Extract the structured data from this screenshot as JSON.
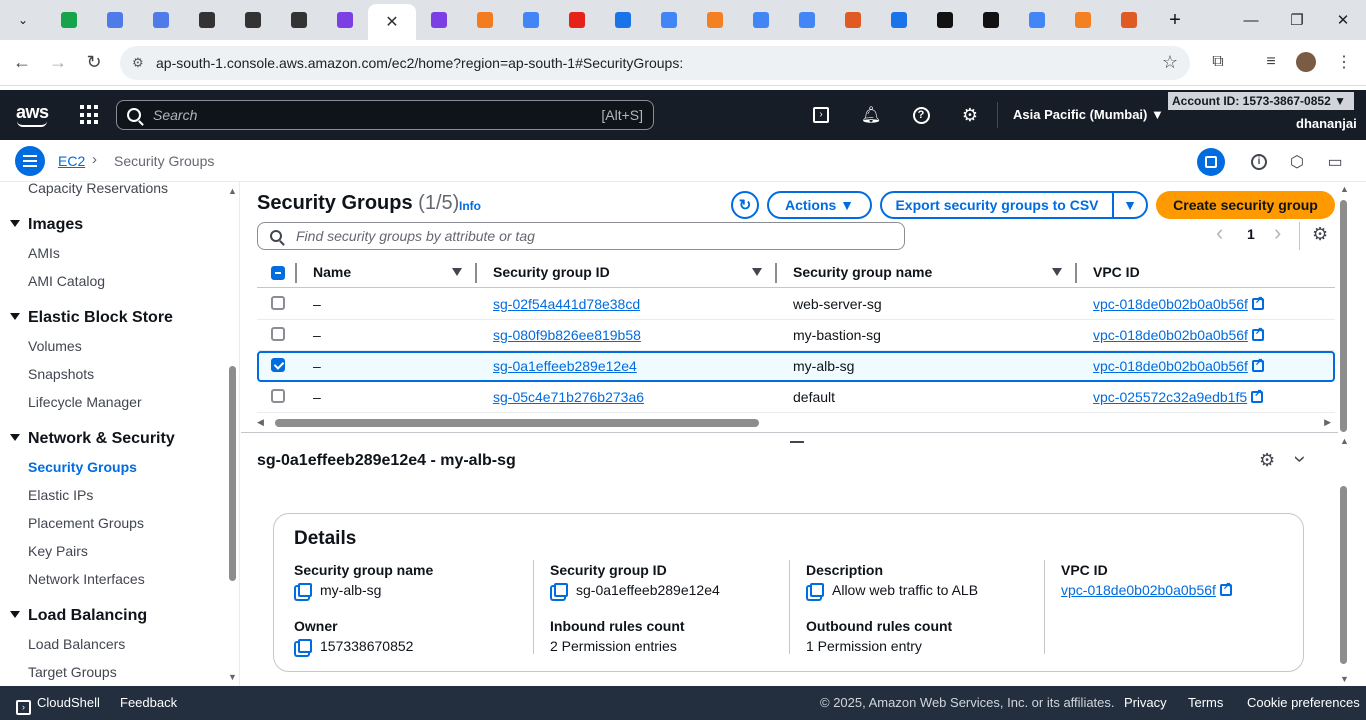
{
  "browser": {
    "active_tab_close": "✕",
    "new_tab": "+",
    "url": "ap-south-1.console.aws.amazon.com/ec2/home?region=ap-south-1#SecurityGroups:",
    "tab_favicon_colors": [
      "#16a34a",
      "#4f7be8",
      "#4f7be8",
      "#333",
      "#333",
      "#333",
      "#7b3fe4",
      "#7b3fe4",
      "#f47c20",
      "#4285f4",
      "#e62117",
      "#1a73e8",
      "#4285f4",
      "#f48024",
      "#4285f4",
      "#4285f4",
      "#e05a24",
      "#1a73e8",
      "#111",
      "#111",
      "#4285f4",
      "#f48024",
      "#e05a24"
    ]
  },
  "aws_nav": {
    "logo": "aws",
    "search_placeholder": "Search",
    "search_hint": "[Alt+S]",
    "region": "Asia Pacific (Mumbai) ▼",
    "account": "Account ID: 1573-3867-0852 ▼",
    "username": "dhananjai"
  },
  "breadcrumb": {
    "root": "EC2",
    "separator": "›",
    "current": "Security Groups"
  },
  "sidebar": {
    "top_item": "Capacity Reservations",
    "sections": [
      {
        "title": "Images",
        "items": [
          "AMIs",
          "AMI Catalog"
        ]
      },
      {
        "title": "Elastic Block Store",
        "items": [
          "Volumes",
          "Snapshots",
          "Lifecycle Manager"
        ]
      },
      {
        "title": "Network & Security",
        "items": [
          "Security Groups",
          "Elastic IPs",
          "Placement Groups",
          "Key Pairs",
          "Network Interfaces"
        ]
      },
      {
        "title": "Load Balancing",
        "items": [
          "Load Balancers",
          "Target Groups"
        ]
      }
    ]
  },
  "main": {
    "title": "Security Groups",
    "count": "(1/5)",
    "info": "Info",
    "actions_label": "Actions ▼",
    "export_label": "Export security groups to CSV",
    "export_dropdown": "▼",
    "create_label": "Create security group",
    "filter_placeholder": "Find security groups by attribute or tag",
    "page_number": "1",
    "prev": "‹",
    "next": "›",
    "columns": [
      "Name",
      "Security group ID",
      "Security group name",
      "VPC ID"
    ],
    "rows": [
      {
        "name": "–",
        "id": "sg-02f54a441d78e38cd",
        "sg_name": "web-server-sg",
        "vpc": "vpc-018de0b02b0a0b56f",
        "selected": false
      },
      {
        "name": "–",
        "id": "sg-080f9b826ee819b58",
        "sg_name": "my-bastion-sg",
        "vpc": "vpc-018de0b02b0a0b56f",
        "selected": false
      },
      {
        "name": "–",
        "id": "sg-0a1effeeb289e12e4",
        "sg_name": "my-alb-sg",
        "vpc": "vpc-018de0b02b0a0b56f",
        "selected": true
      },
      {
        "name": "–",
        "id": "sg-05c4e71b276b273a6",
        "sg_name": "default",
        "vpc": "vpc-025572c32a9edb1f5",
        "selected": false
      }
    ]
  },
  "detail": {
    "title": "sg-0a1effeeb289e12e4 - my-alb-sg",
    "card_title": "Details",
    "fields": [
      {
        "key": "Security group name",
        "value": "my-alb-sg"
      },
      {
        "key": "Security group ID",
        "value": "sg-0a1effeeb289e12e4"
      },
      {
        "key": "Description",
        "value": "Allow web traffic to ALB"
      },
      {
        "key": "VPC ID",
        "value": "vpc-018de0b02b0a0b56f"
      },
      {
        "key": "Owner",
        "value": "157338670852"
      },
      {
        "key": "Inbound rules count",
        "value": "2 Permission entries"
      },
      {
        "key": "Outbound rules count",
        "value": "1 Permission entry"
      }
    ]
  },
  "footer": {
    "cloudshell": "CloudShell",
    "feedback": "Feedback",
    "copyright": "© 2025, Amazon Web Services, Inc. or its affiliates.",
    "privacy": "Privacy",
    "terms": "Terms",
    "cookies": "Cookie preferences"
  },
  "colors": {
    "aws_nav_bg": "#161d26",
    "link_blue": "#006ce0",
    "primary_orange": "#ff9900",
    "footer_bg": "#232f3e"
  }
}
